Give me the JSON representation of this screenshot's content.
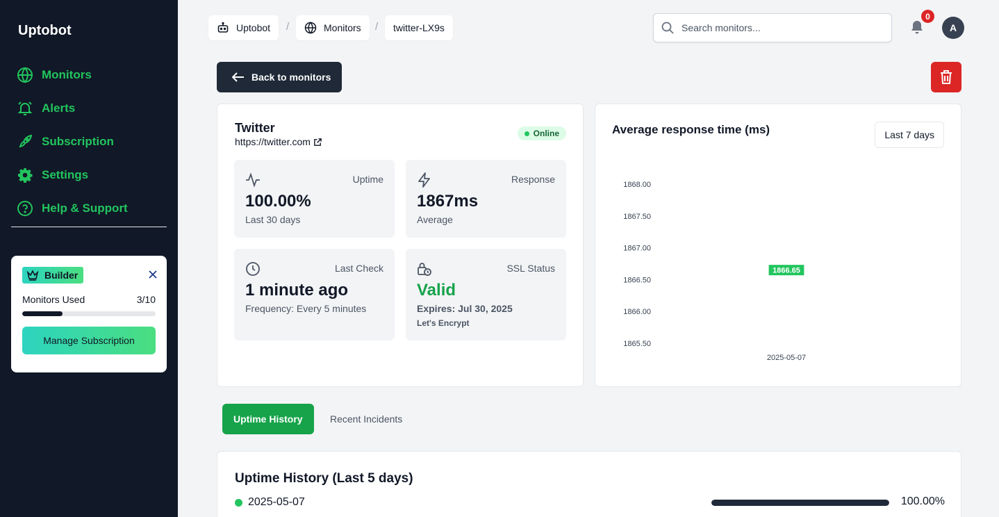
{
  "app": {
    "name": "Uptobot"
  },
  "sidebar": {
    "items": [
      {
        "label": "Monitors",
        "icon": "globe-icon"
      },
      {
        "label": "Alerts",
        "icon": "alarm-icon"
      },
      {
        "label": "Subscription",
        "icon": "rocket-icon"
      },
      {
        "label": "Settings",
        "icon": "gear-icon"
      },
      {
        "label": "Help & Support",
        "icon": "help-circle-icon"
      }
    ],
    "plan": {
      "name": "Builder",
      "usage_label": "Monitors Used",
      "usage_value": "3/10",
      "usage_fraction": 0.3,
      "button_label": "Manage Subscription"
    }
  },
  "breadcrumb": [
    {
      "label": "Uptobot",
      "icon": "robot-icon"
    },
    {
      "label": "Monitors",
      "icon": "globe-icon"
    },
    {
      "label": "twitter-LX9s"
    }
  ],
  "header": {
    "search_placeholder": "Search monitors...",
    "notification_count": "0",
    "avatar_initial": "A"
  },
  "actions": {
    "back_label": "Back to monitors"
  },
  "monitor": {
    "name": "Twitter",
    "url": "https://twitter.com",
    "status": "Online",
    "stats": {
      "uptime": {
        "label": "Uptime",
        "value": "100.00%",
        "sub": "Last 30 days"
      },
      "response": {
        "label": "Response",
        "value": "1867ms",
        "sub": "Average"
      },
      "last_check": {
        "label": "Last Check",
        "value": "1 minute ago",
        "sub": "Frequency: Every 5 minutes"
      },
      "ssl": {
        "label": "SSL Status",
        "value": "Valid",
        "sub": "Expires: Jul 30, 2025",
        "issuer": "Let's Encrypt"
      }
    }
  },
  "chart": {
    "title": "Average response time (ms)",
    "range_label": "Last 7 days"
  },
  "chart_data": {
    "type": "scatter",
    "title": "Average response time (ms)",
    "x": [
      "2025-05-07"
    ],
    "series": [
      {
        "values": [
          1866.65
        ],
        "labels": [
          "1866.65"
        ]
      }
    ],
    "y_ticks": [
      "1868.00",
      "1867.50",
      "1867.00",
      "1866.50",
      "1866.00",
      "1865.50"
    ],
    "ylim": [
      1865.5,
      1868.0
    ],
    "grid": false,
    "colors": {
      "label_bg": "#22c55e"
    }
  },
  "tabs": [
    {
      "label": "Uptime History",
      "active": true
    },
    {
      "label": "Recent Incidents",
      "active": false
    }
  ],
  "history": {
    "title": "Uptime History (Last 5 days)",
    "rows": [
      {
        "date": "2025-05-07",
        "percent": "100.00%",
        "fraction": 1.0
      }
    ]
  },
  "colors": {
    "sidebar_bg": "#111827",
    "accent_green": "#22c55e",
    "success": "#16a34a",
    "danger": "#dc2626",
    "dark_button": "#1f2937"
  }
}
